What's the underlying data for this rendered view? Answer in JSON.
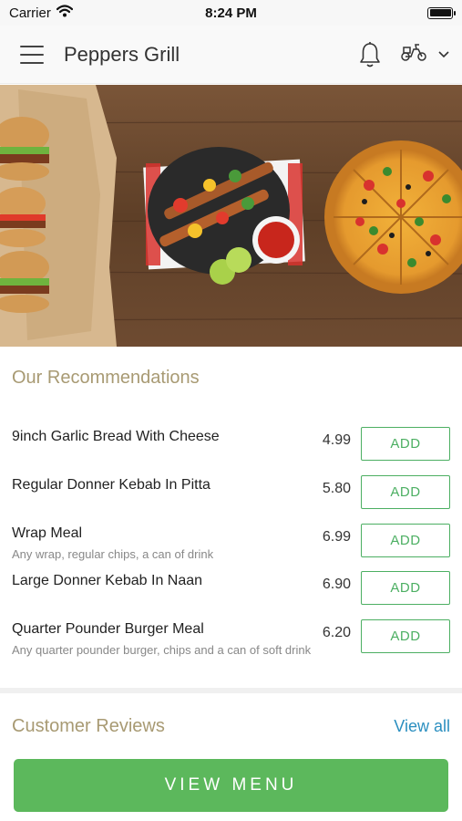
{
  "status_bar": {
    "carrier": "Carrier",
    "time": "8:24 PM",
    "battery_level": 1.0
  },
  "header": {
    "title": "Peppers Grill",
    "icons": {
      "menu": "hamburger-menu-icon",
      "notification": "bell-icon",
      "delivery": "scooter-icon",
      "dropdown": "chevron-down-icon"
    }
  },
  "recommendations": {
    "title": "Our Recommendations",
    "add_label": "ADD",
    "items": [
      {
        "name": "9inch Garlic Bread With Cheese",
        "description": "",
        "price": "4.99"
      },
      {
        "name": "Regular Donner Kebab In Pitta",
        "description": "",
        "price": "5.80"
      },
      {
        "name": "Wrap Meal",
        "description": "Any wrap, regular chips, a can of drink",
        "price": "6.99"
      },
      {
        "name": "Large Donner Kebab In Naan",
        "description": "",
        "price": "6.90"
      },
      {
        "name": "Quarter Pounder Burger Meal",
        "description": "Any quarter pounder burger, chips and a can of soft drink",
        "price": "6.20"
      }
    ]
  },
  "reviews": {
    "title": "Customer Reviews",
    "view_all": "View all"
  },
  "footer": {
    "view_menu": "VIEW MENU"
  },
  "colors": {
    "accent_green": "#5cb85c",
    "add_border": "#4caf62",
    "section_title": "#a89a73",
    "link_blue": "#2b8fc0"
  }
}
